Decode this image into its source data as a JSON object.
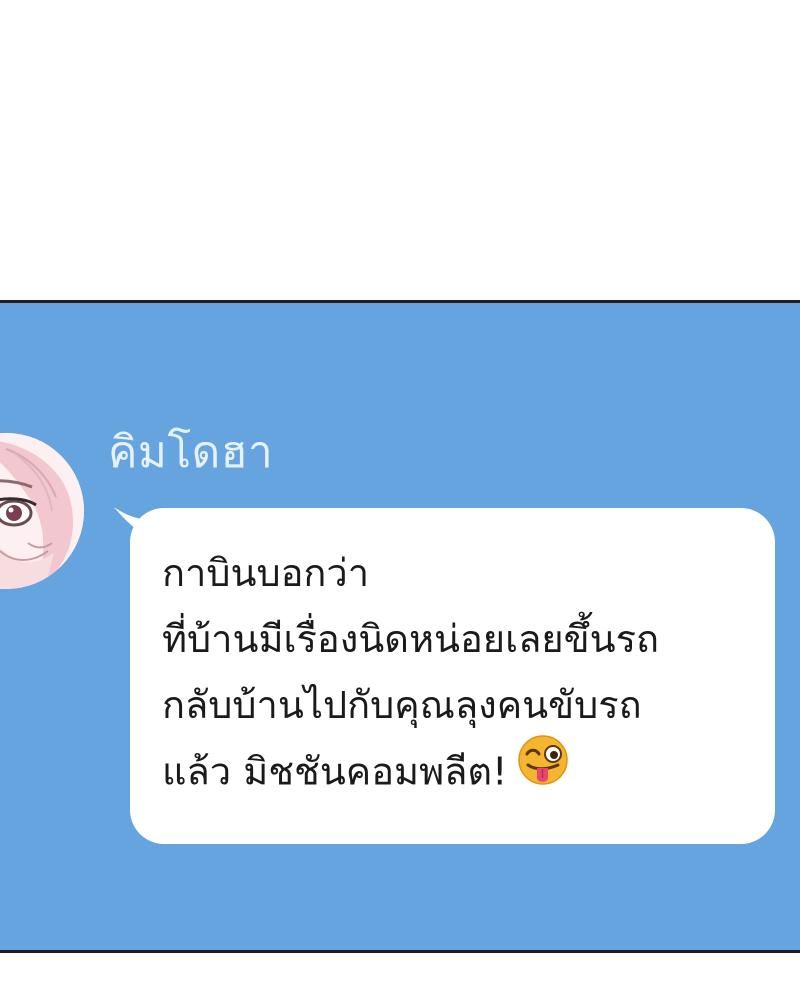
{
  "chat": {
    "sender": {
      "name": "คิมโดฮา",
      "avatar": "avatar-portrait"
    },
    "message": {
      "lines": [
        "กาบินบอกว่า",
        "ที่บ้านมีเรื่องนิดหน่อยเลยขึ้นรถ",
        "กลับบ้านไปกับคุณลุงคนขับรถ",
        "แล้ว มิชชันคอมพลีต!"
      ],
      "emoji": "winking-face-with-tongue-icon"
    },
    "colors": {
      "background": "#65a4df",
      "bubble": "#ffffff",
      "name_text": "#e7f1fb",
      "message_text": "#1a1a1a",
      "emoji": "#f5b52e"
    }
  }
}
